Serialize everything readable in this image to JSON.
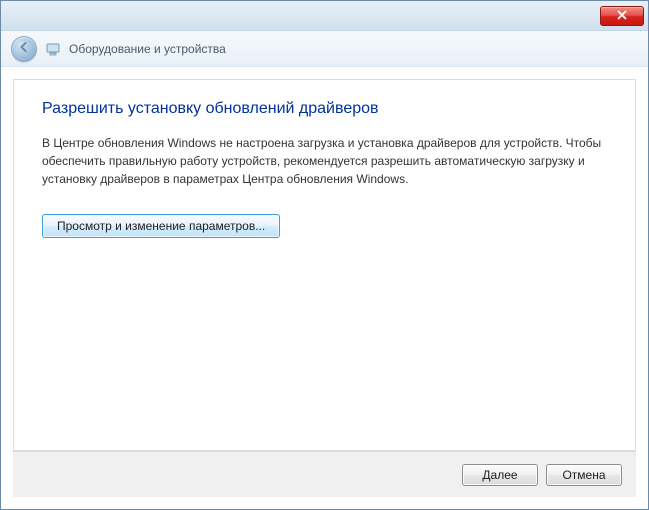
{
  "header": {
    "title": "Оборудование и устройства"
  },
  "main": {
    "heading": "Разрешить установку обновлений драйверов",
    "body": "В Центре обновления Windows не настроена загрузка и установка драйверов для устройств. Чтобы обеспечить правильную работу устройств, рекомендуется разрешить автоматическую загрузку и установку драйверов в параметрах Центра обновления Windows.",
    "action_button": "Просмотр и изменение параметров..."
  },
  "footer": {
    "next": "Далее",
    "cancel": "Отмена"
  }
}
